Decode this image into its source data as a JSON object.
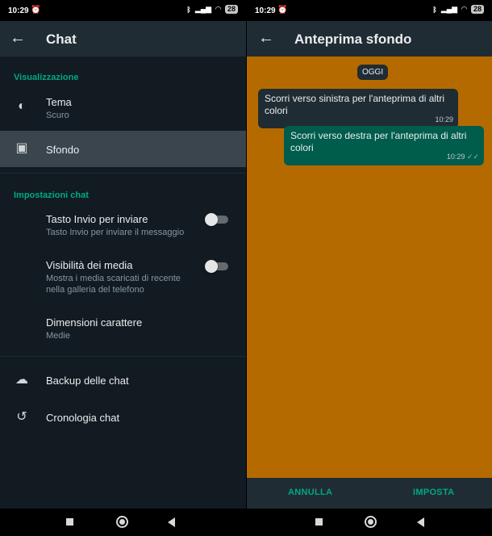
{
  "status": {
    "time": "10:29",
    "battery": "28"
  },
  "left": {
    "title": "Chat",
    "section_display": "Visualizzazione",
    "theme": {
      "label": "Tema",
      "value": "Scuro"
    },
    "wallpaper": {
      "label": "Sfondo"
    },
    "section_chat": "Impostazioni chat",
    "enter_send": {
      "label": "Tasto Invio per inviare",
      "desc": "Tasto Invio per inviare il messaggio"
    },
    "media_visibility": {
      "label": "Visibilità dei media",
      "desc_line1": "Mostra i media scaricati di recente",
      "desc_line2": "nella galleria del telefono"
    },
    "font_size": {
      "label": "Dimensioni carattere",
      "value": "Medie"
    },
    "backup": {
      "label": "Backup delle chat"
    },
    "history": {
      "label": "Cronologia chat"
    }
  },
  "right": {
    "title": "Anteprima sfondo",
    "date_chip": "OGGI",
    "msg_in": {
      "text": "Scorri verso sinistra per l'anteprima di altri colori",
      "time": "10:29"
    },
    "msg_out": {
      "text": "Scorri verso destra per l'anteprima di altri colori",
      "time": "10:29"
    },
    "cancel": "ANNULLA",
    "set": "IMPOSTA",
    "wallpaper_color": "#b56a00"
  }
}
